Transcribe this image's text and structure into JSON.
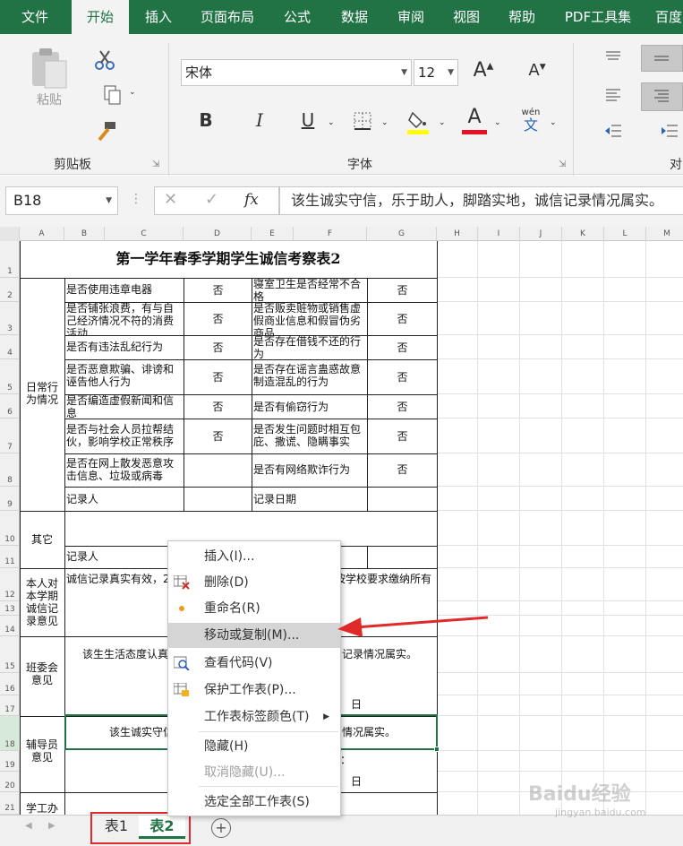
{
  "tabs": [
    {
      "label": "文件"
    },
    {
      "label": "开始"
    },
    {
      "label": "插入"
    },
    {
      "label": "页面布局"
    },
    {
      "label": "公式"
    },
    {
      "label": "数据"
    },
    {
      "label": "审阅"
    },
    {
      "label": "视图"
    },
    {
      "label": "帮助"
    },
    {
      "label": "PDF工具集"
    },
    {
      "label": "百度"
    }
  ],
  "ribbon": {
    "clipboard": {
      "label": "剪贴板",
      "paste": "粘贴"
    },
    "font": {
      "label": "字体",
      "name": "宋体",
      "size": "12",
      "bold": "B",
      "italic": "I",
      "underline": "U",
      "wen": "wén",
      "wen_char": "文"
    },
    "align": {
      "label": "对"
    },
    "colors": {
      "highlight": "#ffff00",
      "font": "#e81123",
      "accent": "#217346"
    }
  },
  "formula_bar": {
    "name_box": "B18",
    "fx": "fx",
    "formula": "该生诚实守信，乐于助人，脚踏实地，诚信记录情况属实。"
  },
  "columns": [
    "A",
    "B",
    "C",
    "D",
    "E",
    "F",
    "G",
    "H",
    "I",
    "J",
    "K",
    "L",
    "M"
  ],
  "rows": [
    "1",
    "2",
    "3",
    "4",
    "5",
    "6",
    "7",
    "8",
    "9",
    "10",
    "11",
    "12",
    "13",
    "14",
    "15",
    "16",
    "17",
    "18",
    "19",
    "20",
    "21"
  ],
  "sheet": {
    "title": "第一学年春季学期学生诚信考察表2",
    "left_labels": {
      "daily": "日常行为情况",
      "other": "其它",
      "self": "本人对本学期诚信记录意见",
      "class": "班委会意见",
      "tutor": "辅导员意见",
      "office": "学工办"
    },
    "items": [
      {
        "left": "是否使用违章电器",
        "left_val": "否",
        "right": "寝室卫生是否经常不合格",
        "right_val": "否"
      },
      {
        "left": "是否铺张浪费，有与自己经济情况不符的消费活动",
        "left_val": "否",
        "right": "是否贩卖赃物或销售虚假商业信息和假冒伪劣商品",
        "right_val": "否"
      },
      {
        "left": "是否有违法乱纪行为",
        "left_val": "否",
        "right": "是否存在借钱不还的行为",
        "right_val": "否"
      },
      {
        "left": "是否恶意欺骗、诽谤和诬告他人行为",
        "left_val": "否",
        "right": "是否存在谣言蛊惑故意制造混乱的行为",
        "right_val": "否"
      },
      {
        "left": "是否编造虚假新闻和信息",
        "left_val": "否",
        "right": "是否有偷窃行为",
        "right_val": "否"
      },
      {
        "left": "是否与社会人员拉帮结伙，影响学校正常秩序",
        "left_val": "否",
        "right": "是否发生问题时相互包庇、撒谎、隐瞒事实",
        "right_val": "否"
      },
      {
        "left": "是否在网上散发恶意攻击信息、垃圾或病毒",
        "left_val": "",
        "right": "是否有网络欺诈行为",
        "right_val": "否"
      }
    ],
    "recorder": "记录人",
    "record_date": "记录日期",
    "recorder2": "记录人",
    "self_text": "诚信记录真实有效，2",
    "self_text_right": "按学校要求缴纳所有",
    "class_text": "该生生活态度认真",
    "class_text_right": "记录情况属实。",
    "day1": "日",
    "tutor_text": "该生诚实守信",
    "tutor_text_right": "情况属实。",
    "colon": "：",
    "day2": "日"
  },
  "context_menu": [
    {
      "label": "插入(I)...",
      "icon": "none",
      "disabled": false
    },
    {
      "label": "删除(D)",
      "icon": "delete-sheet-icon",
      "disabled": false
    },
    {
      "label": "重命名(R)",
      "icon": "orange-dot-icon",
      "disabled": false
    },
    {
      "label": "移动或复制(M)...",
      "icon": "none",
      "disabled": false,
      "highlighted": true
    },
    {
      "label": "查看代码(V)",
      "icon": "view-code-icon",
      "disabled": false
    },
    {
      "label": "保护工作表(P)...",
      "icon": "protect-sheet-icon",
      "disabled": false
    },
    {
      "label": "工作表标签颜色(T)",
      "icon": "none",
      "disabled": false,
      "submenu": true
    },
    {
      "label": "隐藏(H)",
      "icon": "none",
      "disabled": false
    },
    {
      "label": "取消隐藏(U)...",
      "icon": "none",
      "disabled": true
    },
    {
      "label": "选定全部工作表(S)",
      "icon": "none",
      "disabled": false
    }
  ],
  "sheet_tabs": [
    {
      "label": "表1",
      "active": false
    },
    {
      "label": "表2",
      "active": true
    }
  ],
  "watermark": {
    "main": "Baidu经验",
    "sub": "jingyan.baidu.com"
  }
}
